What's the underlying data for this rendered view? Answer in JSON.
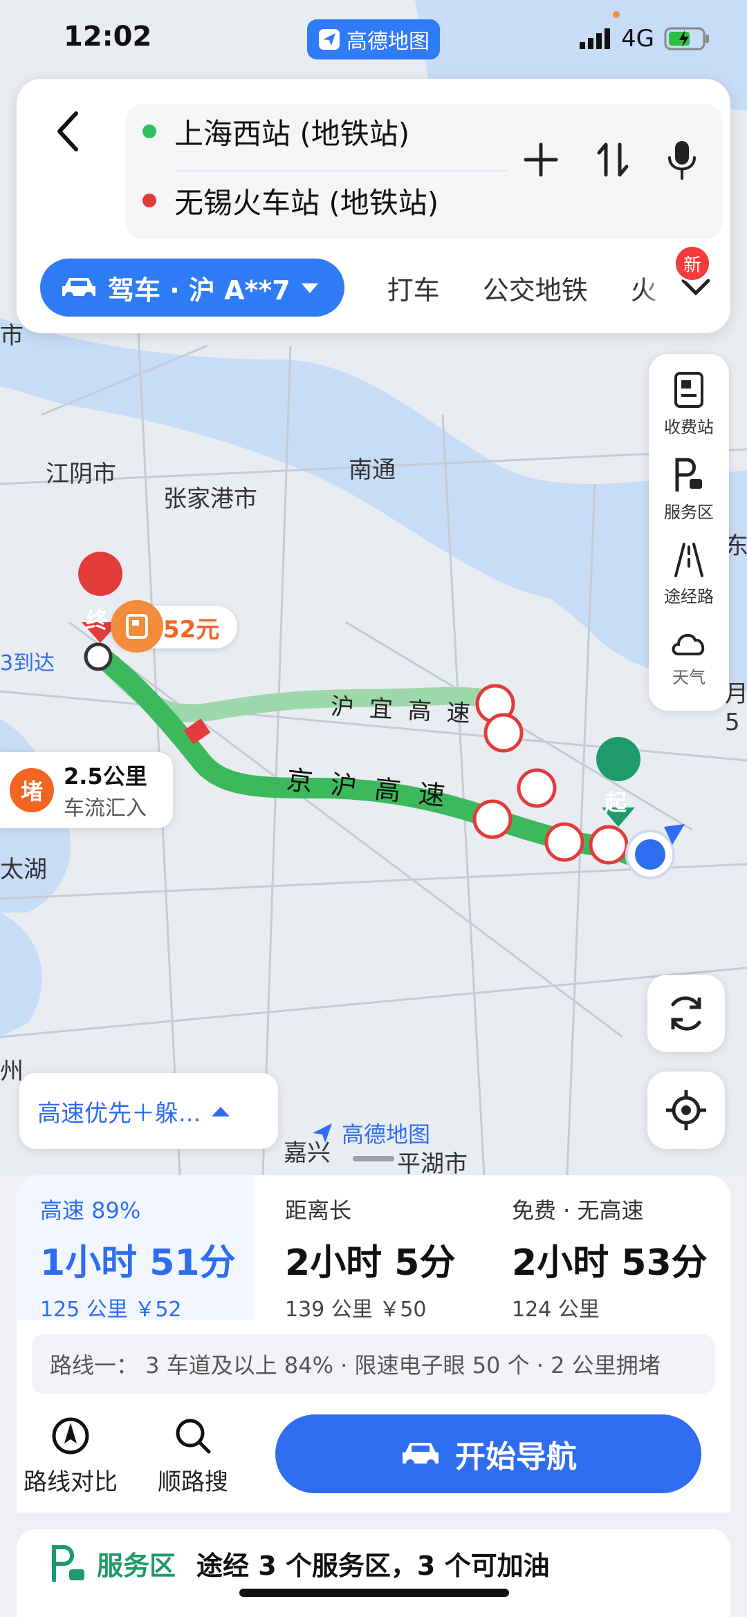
{
  "status_bar": {
    "time": "12:02",
    "app_name": "高德地图",
    "network": "4G"
  },
  "route_input": {
    "origin": "上海西站 (地铁站)",
    "destination": "无锡火车站 (地铁站)"
  },
  "modes": {
    "active": "驾车 · 沪 A**7",
    "tabs": [
      "打车",
      "公交地铁",
      "火车"
    ],
    "new_badge": "新"
  },
  "map_tools": [
    {
      "label": "收费站",
      "icon": "toll-station-icon"
    },
    {
      "label": "服务区",
      "icon": "service-area-icon"
    },
    {
      "label": "途经路",
      "icon": "via-road-icon"
    },
    {
      "label": "天气",
      "icon": "weather-icon"
    }
  ],
  "map": {
    "places": [
      "江阴市",
      "张家港市",
      "南通",
      "太湖",
      "嘉兴",
      "平湖市"
    ],
    "edge_fragments": [
      "市",
      "3到达",
      "东",
      "月5",
      "州"
    ],
    "roads": [
      "沪宜高速",
      "京沪高速"
    ],
    "end_marker": "终",
    "start_marker": "起",
    "toll_price": "52元",
    "jam": {
      "icon": "堵",
      "distance": "2.5公里",
      "desc": "车流汇入"
    },
    "logo": "高德地图"
  },
  "route_pref": "高速优先＋躲...",
  "routes": [
    {
      "tag": "高速 89%",
      "time": "1小时 51分",
      "meta": "125 公里  ￥52",
      "active": true
    },
    {
      "tag": "距离长",
      "time": "2小时 5分",
      "meta": "139 公里  ￥50",
      "active": false
    },
    {
      "tag": "免费 · 无高速",
      "time": "2小时 53分",
      "meta": "124 公里",
      "active": false
    }
  ],
  "route_summary": "路线一：  3 车道及以上 84% · 限速电子眼 50 个 · 2 公里拥堵",
  "actions": {
    "compare": "路线对比",
    "search_along": "顺路搜",
    "start_nav": "开始导航"
  },
  "service": {
    "label": "服务区",
    "text": "途经 3 个服务区，3 个可加油"
  },
  "colors": {
    "accent": "#2f6df0",
    "route_green": "#3cb95c",
    "jam": "#f26522",
    "end": "#e23b3b"
  }
}
